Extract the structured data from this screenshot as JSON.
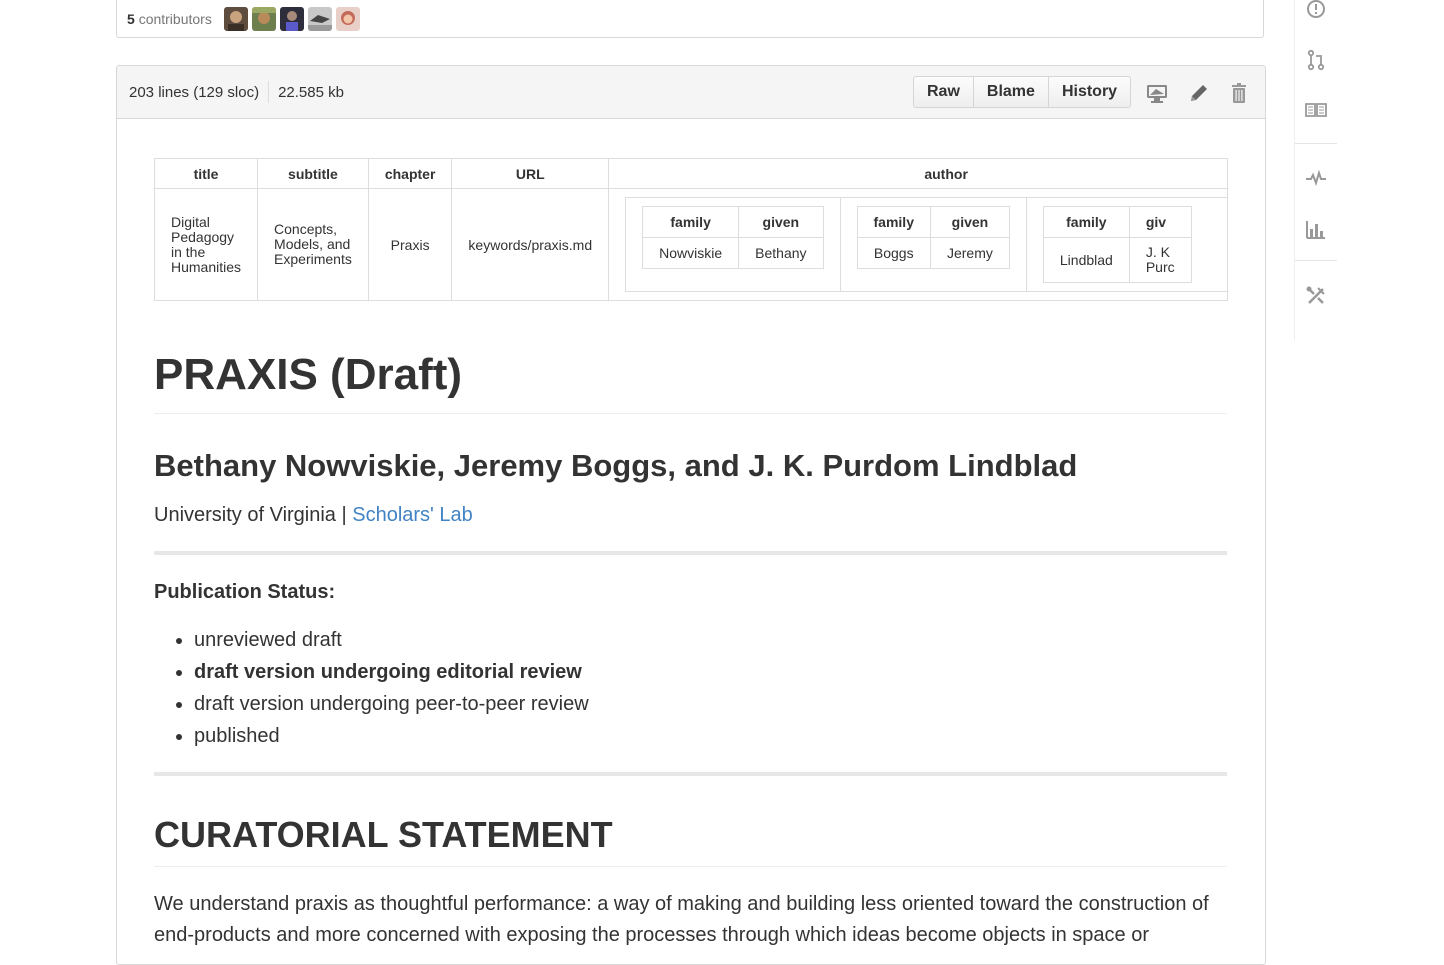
{
  "contributors": {
    "count": "5",
    "label": "contributors",
    "avatars": [
      {
        "name": "avatar-1",
        "color": "#6b5a4a"
      },
      {
        "name": "avatar-2",
        "color": "#7a8a5a"
      },
      {
        "name": "avatar-3",
        "color": "#3a3a4a"
      },
      {
        "name": "avatar-4",
        "color": "#9a9a9a"
      },
      {
        "name": "avatar-5",
        "color": "#c47a6a"
      }
    ]
  },
  "file_header": {
    "lines": "203 lines (129 sloc)",
    "size": "22.585 kb",
    "raw_label": "Raw",
    "blame_label": "Blame",
    "history_label": "History",
    "icons": [
      "desktop-icon",
      "pencil-icon",
      "trash-icon"
    ]
  },
  "meta_table": {
    "headers": {
      "title": "title",
      "subtitle": "subtitle",
      "chapter": "chapter",
      "url": "URL",
      "author": "author"
    },
    "row": {
      "title": [
        "Digital",
        "Pedagogy",
        "in the",
        "Humanities"
      ],
      "subtitle": [
        "Concepts,",
        "Models, and",
        "Experiments"
      ],
      "chapter": "Praxis",
      "url": "keywords/praxis.md"
    },
    "authors": [
      {
        "family_label": "family",
        "given_label": "given",
        "family": "Nowviskie",
        "given": "Bethany"
      },
      {
        "family_label": "family",
        "given_label": "given",
        "family": "Boggs",
        "given": "Jeremy"
      },
      {
        "family_label": "family",
        "given_label": "giv",
        "family": "Lindblad",
        "given": "J. K",
        "given2": "Purc"
      }
    ]
  },
  "document": {
    "title": "PRAXIS (Draft)",
    "authors": "Bethany Nowviskie, Jeremy Boggs, and J. K. Purdom Lindblad",
    "affiliation": "University of Virginia | ",
    "affiliation_link": "Scholars' Lab",
    "status_label": "Publication Status:",
    "status_items": [
      "unreviewed draft",
      "draft version undergoing editorial review",
      "draft version undergoing peer-to-peer review",
      "published"
    ],
    "section_heading": "CURATORIAL STATEMENT",
    "body_line1": "We understand praxis as thoughtful performance: a way of making and building less oriented toward the construction of",
    "body_line2": "end-products and more concerned with exposing the processes through which ideas become objects in space or"
  },
  "sidebar": {
    "icons": [
      "issue-icon",
      "pull-request-icon",
      "wiki-icon",
      "pulse-icon",
      "graph-icon",
      "settings-icon"
    ]
  },
  "colors": {
    "link": "#4183c4",
    "text": "#333333",
    "border": "#d8d8d8",
    "icon": "#999999"
  }
}
